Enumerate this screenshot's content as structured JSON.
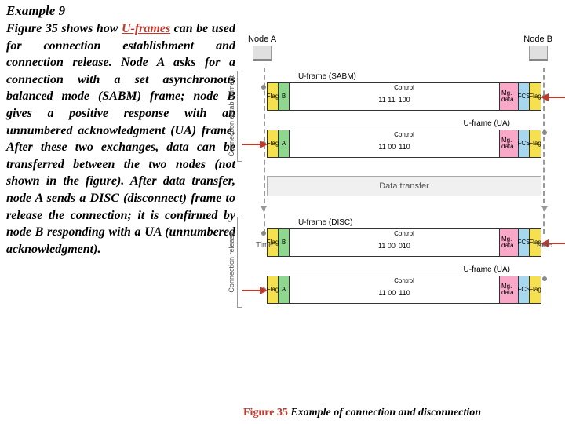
{
  "title": "Example 9",
  "paragraph_pre": "Figure 35 shows how ",
  "uframes": "U-frames",
  "paragraph_post": " can be used for connection establishment and connection release. Node A asks for a connection with a set asynchronous balanced mode (SABM) frame; node B gives a positive response with an unnumbered acknowledgment (UA) frame. After these two exchanges, data can be transferred between the two nodes (not shown in the figure). After data transfer, node A sends a DISC (disconnect) frame to release the connection; it is confirmed by node B responding with a UA (unnumbered acknowledgment).",
  "nodeA": "Node A",
  "nodeB": "Node B",
  "time": "Time",
  "phase1": "Connection\nestablishment",
  "phase2": "Connection\nrelease",
  "data_transfer": "Data transfer",
  "frames": {
    "sabm": {
      "title": "U-frame (SABM)",
      "addr": "B",
      "bits1": "11 11",
      "bits2": "100"
    },
    "ua1": {
      "title": "U-frame (UA)",
      "addr": "A",
      "bits1": "11 00",
      "bits2": "110"
    },
    "disc": {
      "title": "U-frame (DISC)",
      "addr": "B",
      "bits1": "11 00",
      "bits2": "010"
    },
    "ua2": {
      "title": "U-frame (UA)",
      "addr": "A",
      "bits1": "11 00",
      "bits2": "110"
    }
  },
  "seg": {
    "flag": "Flag",
    "control": "Control",
    "mg": "Mg. data",
    "fcs": "FCS"
  },
  "caption_num": "Figure 35",
  "caption_body": "  Example of connection and disconnection"
}
